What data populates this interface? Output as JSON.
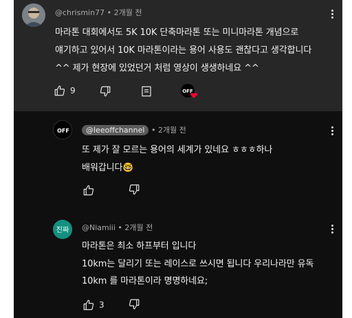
{
  "comment_main": {
    "handle": "@chrismin77",
    "time": "2개월 전",
    "lines": [
      "마라톤 대회에서도 5K 10K 단축마라톤 또는 미니마라톤 개념으로",
      "얘기하고 있어서 10K 마라톤이라는 용어 사용도 괜찮다고 생각합니다",
      "^^ 제가 현장에 있었던거 처럼 영상이 생생하네요 ^^"
    ],
    "likes": "9"
  },
  "reply_1": {
    "avatar_text": "OFF",
    "handle": "@leeoffchannel",
    "time": "2개월 전",
    "lines": [
      "또 제가 잘 모르는 용어의 세계가 있네요 ㅎㅎㅎ하나",
      "배워갑니다🤓"
    ]
  },
  "reply_2": {
    "avatar_text": "진짜",
    "handle": "@Niamiii",
    "time": "2개월 전",
    "lines": [
      "마라톤은 최소 하프부터 입니다",
      "10km는 달리기 또는 레이스로 쓰시면 됩니다 우리나라만 유독",
      "10km 를 마라톤이라 명명하네요;"
    ],
    "likes": "3"
  },
  "colors": {
    "background": "#0f0f0f",
    "highlight": "#272727",
    "text": "#f1f1f1",
    "meta": "#aaaaaa",
    "heart": "#ff0033"
  },
  "icons": [
    "like-icon",
    "dislike-icon",
    "reply-icon",
    "more-vert-icon",
    "creator-heart-icon"
  ]
}
